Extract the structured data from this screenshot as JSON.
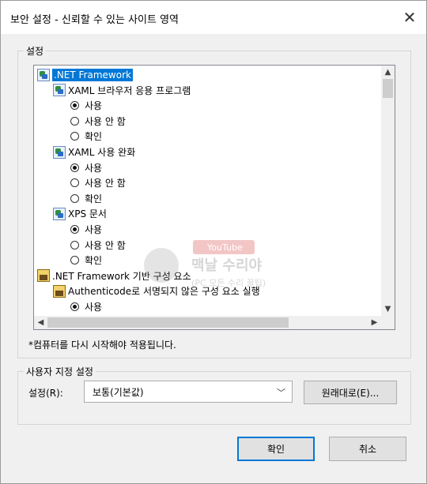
{
  "window": {
    "title": "보안 설정 - 신뢰할 수 있는 사이트 영역",
    "close_symbol": "✕"
  },
  "settings": {
    "group_label": "설정",
    "tree": [
      {
        "type": "category",
        "icon": "net-framework-icon",
        "label": ".NET Framework",
        "selected": true
      },
      {
        "type": "option",
        "icon": "net-framework-icon",
        "label": "XAML 브라우저 응용 프로그램"
      },
      {
        "type": "radio",
        "label": "사용",
        "checked": true
      },
      {
        "type": "radio",
        "label": "사용 안 함",
        "checked": false
      },
      {
        "type": "radio",
        "label": "확인",
        "checked": false
      },
      {
        "type": "option",
        "icon": "net-framework-icon",
        "label": "XAML 사용 완화"
      },
      {
        "type": "radio",
        "label": "사용",
        "checked": true
      },
      {
        "type": "radio",
        "label": "사용 안 함",
        "checked": false
      },
      {
        "type": "radio",
        "label": "확인",
        "checked": false
      },
      {
        "type": "option",
        "icon": "net-framework-icon",
        "label": "XPS 문서"
      },
      {
        "type": "radio",
        "label": "사용",
        "checked": true
      },
      {
        "type": "radio",
        "label": "사용 안 함",
        "checked": false
      },
      {
        "type": "radio",
        "label": "확인",
        "checked": false
      },
      {
        "type": "category",
        "icon": "component-icon",
        "label": ".NET Framework 기반 구성 요소",
        "selected": false
      },
      {
        "type": "option",
        "icon": "component-icon",
        "label": "Authenticode로 서명되지 않은 구성 요소 실행"
      },
      {
        "type": "radio",
        "label": "사용",
        "checked": true
      }
    ],
    "note": "*컴퓨터를 다시 시작해야 적용됩니다."
  },
  "custom": {
    "group_label": "사용자 지정 설정",
    "field_label": "설정(R):",
    "select_value": "보통(기본값)",
    "reset_button": "원래대로(E)..."
  },
  "footer": {
    "ok": "확인",
    "cancel": "취소"
  },
  "watermark": {
    "line1": "YouTube",
    "line2": "맥날 수리야",
    "line3": "(PC 모든 수리 꿀팁)"
  }
}
